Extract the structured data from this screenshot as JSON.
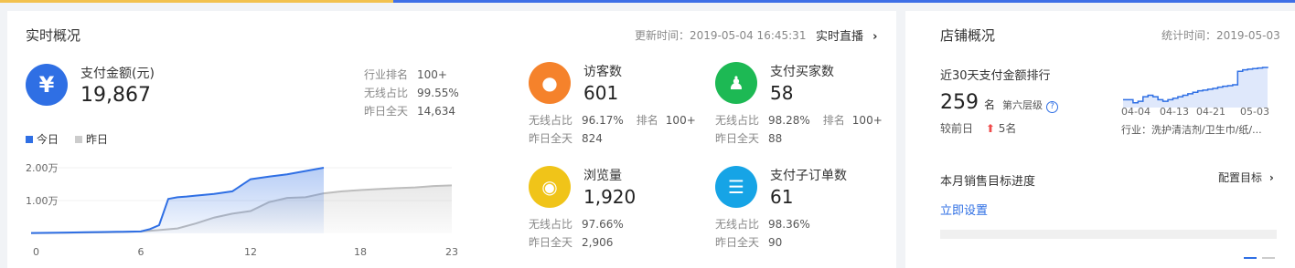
{
  "realtime": {
    "title": "实时概况",
    "update_time": "更新时间：2019-05-04 16:45:31",
    "live_link": "实时直播",
    "payment": {
      "icon": "yen-icon",
      "label": "支付金额(元)",
      "value": "19,867",
      "stats": [
        {
          "label": "行业排名",
          "value": "100+"
        },
        {
          "label": "无线占比",
          "value": "99.55%"
        },
        {
          "label": "昨日全天",
          "value": "14,634"
        }
      ]
    },
    "legend": {
      "today": "今日",
      "yesterday": "昨日"
    },
    "metrics": [
      {
        "id": "visitors",
        "icon": "footprint-icon",
        "color": "#f5822b",
        "label": "访客数",
        "value": "601",
        "wireless_label": "无线占比",
        "wireless_value": "96.17%",
        "rank_label": "排名",
        "rank_value": "100+",
        "yesterday_label": "昨日全天",
        "yesterday_value": "824"
      },
      {
        "id": "buyers",
        "icon": "buyers-icon",
        "color": "#1db954",
        "label": "支付买家数",
        "value": "58",
        "wireless_label": "无线占比",
        "wireless_value": "98.28%",
        "rank_label": "排名",
        "rank_value": "100+",
        "yesterday_label": "昨日全天",
        "yesterday_value": "88"
      },
      {
        "id": "pageviews",
        "icon": "eye-icon",
        "color": "#f0c419",
        "label": "浏览量",
        "value": "1,920",
        "wireless_label": "无线占比",
        "wireless_value": "97.66%",
        "yesterday_label": "昨日全天",
        "yesterday_value": "2,906"
      },
      {
        "id": "suborders",
        "icon": "clipboard-icon",
        "color": "#16a4e6",
        "label": "支付子订单数",
        "value": "61",
        "wireless_label": "无线占比",
        "wireless_value": "98.36%",
        "yesterday_label": "昨日全天",
        "yesterday_value": "90"
      }
    ]
  },
  "chart_data": {
    "type": "area",
    "x_ticks": [
      "0",
      "6",
      "12",
      "18",
      "23"
    ],
    "y_ticks": [
      "2.00万",
      "1.00万"
    ],
    "ylim": [
      0,
      25000
    ],
    "xlim": [
      0,
      23
    ],
    "series": [
      {
        "name": "今日",
        "color": "#2f6fe4",
        "x": [
          0,
          1,
          2,
          3,
          4,
          5,
          6,
          6.5,
          7,
          7.5,
          8,
          8.5,
          9,
          10,
          11,
          12,
          13,
          14,
          15,
          16
        ],
        "y": [
          100,
          180,
          260,
          340,
          420,
          500,
          600,
          1300,
          2500,
          10500,
          11000,
          11200,
          11500,
          12000,
          12800,
          16500,
          17300,
          18000,
          19000,
          20000
        ]
      },
      {
        "name": "昨日",
        "color": "#bdbdbd",
        "x": [
          0,
          1,
          2,
          3,
          4,
          5,
          6,
          7,
          8,
          9,
          10,
          11,
          12,
          13,
          14,
          15,
          16,
          17,
          18,
          19,
          20,
          21,
          22,
          23
        ],
        "y": [
          60,
          120,
          180,
          240,
          320,
          420,
          600,
          1000,
          1500,
          3000,
          4800,
          6000,
          6800,
          9500,
          10800,
          11000,
          12200,
          12800,
          13200,
          13500,
          13800,
          14000,
          14400,
          14634
        ]
      }
    ]
  },
  "store": {
    "title": "店铺概况",
    "stat_time": "统计时间：2019-05-03",
    "rank_title": "近30天支付金额排行",
    "rank_value": "259",
    "rank_unit": "名",
    "tier": "第六层级",
    "help_icon": "help-icon",
    "compare_label": "较前日",
    "change_icon": "arrow-up-icon",
    "change_value": "5名",
    "mini_chart": {
      "x_ticks": [
        "04-04",
        "04-13",
        "04-21",
        "05-03"
      ],
      "values": [
        300,
        300,
        310,
        305,
        290,
        285,
        290,
        300,
        305,
        300,
        295,
        290,
        285,
        280,
        275,
        270,
        268,
        265,
        262,
        258,
        255,
        253,
        250,
        205,
        200,
        198,
        196,
        194,
        192,
        190
      ],
      "industry": "行业：洗护清洁剂/卫生巾/纸/..."
    },
    "target_title": "本月销售目标进度",
    "target_config": "配置目标",
    "set_now": "立即设置"
  }
}
